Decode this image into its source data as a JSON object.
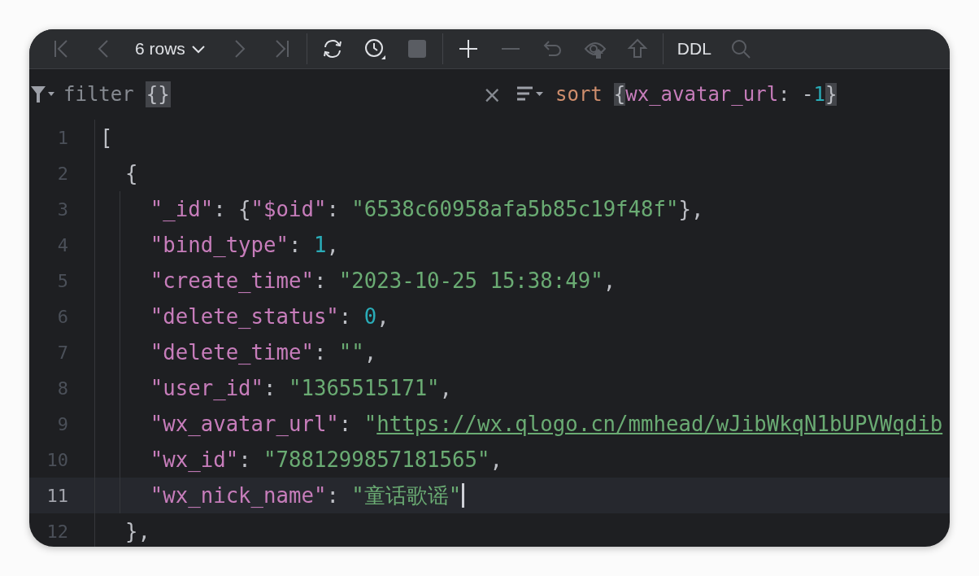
{
  "toolbar": {
    "items": [
      {
        "kind": "first",
        "disabled": true
      },
      {
        "kind": "prev",
        "disabled": true
      },
      {
        "kind": "rows",
        "label": "6 rows",
        "disabled": false
      },
      {
        "kind": "next",
        "disabled": true
      },
      {
        "kind": "last",
        "disabled": true
      },
      {
        "kind": "separator"
      },
      {
        "kind": "refresh",
        "disabled": false
      },
      {
        "kind": "history",
        "disabled": false
      },
      {
        "kind": "stop",
        "disabled": true
      },
      {
        "kind": "separator"
      },
      {
        "kind": "add",
        "disabled": false
      },
      {
        "kind": "remove",
        "disabled": true
      },
      {
        "kind": "revert",
        "disabled": true
      },
      {
        "kind": "preview",
        "disabled": true
      },
      {
        "kind": "submit",
        "disabled": true
      },
      {
        "kind": "separator"
      },
      {
        "kind": "ddl",
        "label": "DDL",
        "disabled": false
      },
      {
        "kind": "search",
        "disabled": true
      }
    ]
  },
  "filter": {
    "label": "filter",
    "value": "{}",
    "clear": "×"
  },
  "sort": {
    "label": "sort",
    "tokens": [
      {
        "kind": "brace",
        "text": "{"
      },
      {
        "kind": "key",
        "text": "wx_avatar_url"
      },
      {
        "kind": "punct",
        "text": ": -"
      },
      {
        "kind": "number",
        "text": "1"
      },
      {
        "kind": "brace",
        "text": "}"
      }
    ]
  },
  "editor": {
    "lines": [
      {
        "number": "1",
        "selected": false,
        "cursor": false,
        "tokens": [
          {
            "kind": "punct",
            "text": "["
          }
        ]
      },
      {
        "number": "2",
        "selected": false,
        "cursor": false,
        "tokens": [
          {
            "kind": "punct",
            "text": "  {"
          }
        ]
      },
      {
        "number": "3",
        "selected": false,
        "cursor": false,
        "tokens": [
          {
            "kind": "key",
            "text": "    \"_id\""
          },
          {
            "kind": "punct",
            "text": ": {"
          },
          {
            "kind": "key",
            "text": "\"$oid\""
          },
          {
            "kind": "punct",
            "text": ": "
          },
          {
            "kind": "string",
            "text": "\"6538c60958afa5b85c19f48f\""
          },
          {
            "kind": "punct",
            "text": "},"
          }
        ]
      },
      {
        "number": "4",
        "selected": false,
        "cursor": false,
        "tokens": [
          {
            "kind": "key",
            "text": "    \"bind_type\""
          },
          {
            "kind": "punct",
            "text": ": "
          },
          {
            "kind": "number",
            "text": "1"
          },
          {
            "kind": "punct",
            "text": ","
          }
        ]
      },
      {
        "number": "5",
        "selected": false,
        "cursor": false,
        "tokens": [
          {
            "kind": "key",
            "text": "    \"create_time\""
          },
          {
            "kind": "punct",
            "text": ": "
          },
          {
            "kind": "string",
            "text": "\"2023-10-25 15:38:49\""
          },
          {
            "kind": "punct",
            "text": ","
          }
        ]
      },
      {
        "number": "6",
        "selected": false,
        "cursor": false,
        "tokens": [
          {
            "kind": "key",
            "text": "    \"delete_status\""
          },
          {
            "kind": "punct",
            "text": ": "
          },
          {
            "kind": "number",
            "text": "0"
          },
          {
            "kind": "punct",
            "text": ","
          }
        ]
      },
      {
        "number": "7",
        "selected": false,
        "cursor": false,
        "tokens": [
          {
            "kind": "key",
            "text": "    \"delete_time\""
          },
          {
            "kind": "punct",
            "text": ": "
          },
          {
            "kind": "string",
            "text": "\"\""
          },
          {
            "kind": "punct",
            "text": ","
          }
        ]
      },
      {
        "number": "8",
        "selected": false,
        "cursor": false,
        "tokens": [
          {
            "kind": "key",
            "text": "    \"user_id\""
          },
          {
            "kind": "punct",
            "text": ": "
          },
          {
            "kind": "string",
            "text": "\"1365515171\""
          },
          {
            "kind": "punct",
            "text": ","
          }
        ]
      },
      {
        "number": "9",
        "selected": false,
        "cursor": false,
        "tokens": [
          {
            "kind": "key",
            "text": "    \"wx_avatar_url\""
          },
          {
            "kind": "punct",
            "text": ": "
          },
          {
            "kind": "string",
            "text": "\""
          },
          {
            "kind": "url",
            "text": "https://wx.qlogo.cn/mmhead/wJibWkqN1bUPVWqdib"
          }
        ]
      },
      {
        "number": "10",
        "selected": false,
        "cursor": false,
        "tokens": [
          {
            "kind": "key",
            "text": "    \"wx_id\""
          },
          {
            "kind": "punct",
            "text": ": "
          },
          {
            "kind": "string",
            "text": "\"7881299857181565\""
          },
          {
            "kind": "punct",
            "text": ","
          }
        ]
      },
      {
        "number": "11",
        "selected": true,
        "cursor": true,
        "tokens": [
          {
            "kind": "key",
            "text": "    \"wx_nick_name\""
          },
          {
            "kind": "punct",
            "text": ": "
          },
          {
            "kind": "string",
            "text": "\"童话歌谣\""
          }
        ]
      },
      {
        "number": "12",
        "selected": false,
        "cursor": false,
        "tokens": [
          {
            "kind": "punct",
            "text": "  },"
          }
        ]
      }
    ]
  }
}
